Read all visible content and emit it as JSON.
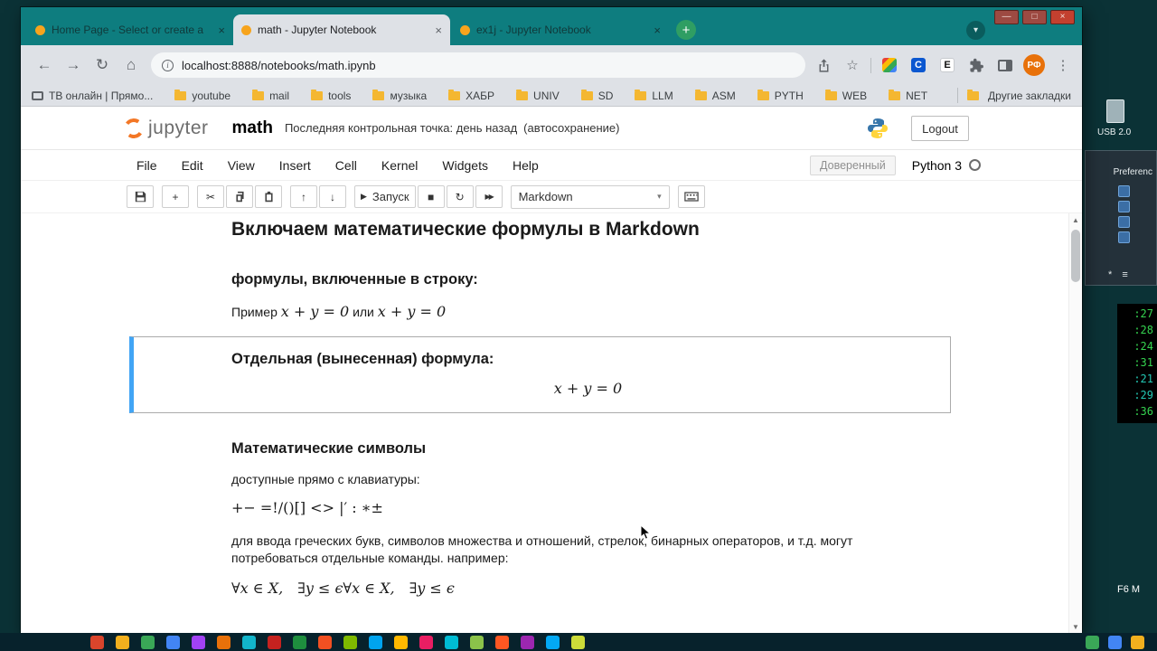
{
  "desktop": {
    "usb_label": "USB 2.0",
    "window_label": "Preferenc",
    "status_glyphs": "* ≡",
    "clock": [
      {
        "t": ":27",
        "c": "#35d450"
      },
      {
        "t": ":28",
        "c": "#35d450"
      },
      {
        "t": ":24",
        "c": "#35d450"
      },
      {
        "t": ":31",
        "c": "#35d450"
      },
      {
        "t": ":21",
        "c": "#23c8b4"
      },
      {
        "t": ":29",
        "c": "#23c8b4"
      },
      {
        "t": ":36",
        "c": "#35d450"
      }
    ],
    "f6_label": "F6 M",
    "taskbar_colors": [
      "#d9452c",
      "#f2b01e",
      "#3aa757",
      "#4285f4",
      "#a142f4",
      "#e8710a",
      "#12b5cb",
      "#c5221f",
      "#1e8e3e",
      "#f25022",
      "#7fba00",
      "#00a4ef",
      "#ffb900",
      "#e91e63",
      "#00bcd4",
      "#8bc34a",
      "#ff5722",
      "#9c27b0",
      "#03a9f4",
      "#cddc39"
    ],
    "taskbar_right_colors": [
      "#3aa757",
      "#4285f4",
      "#f2b01e"
    ]
  },
  "window_controls": {
    "minimize": "—",
    "maximize": "□",
    "close": "×"
  },
  "browser": {
    "tabs": [
      {
        "title": "Home Page - Select or create a",
        "close": "×"
      },
      {
        "title": "math - Jupyter Notebook",
        "close": "×"
      },
      {
        "title": "ex1j - Jupyter Notebook",
        "close": "×"
      }
    ],
    "new_tab_glyph": "+",
    "tab_chevron_glyph": "▾",
    "nav": {
      "back": "←",
      "forward": "→",
      "reload": "↻",
      "home": "⌂"
    },
    "address": {
      "info_glyph": "i",
      "url": "localhost:8888/notebooks/math.ipynb"
    },
    "actions": {
      "star": "☆",
      "ext_c": "C",
      "ext_e": "E",
      "profile": "РФ",
      "menu_dots": "⋮"
    },
    "bookmarks": [
      "ТВ онлайн | Прямо...",
      "youtube",
      "mail",
      "tools",
      "музыка",
      "ХАБР",
      "UNIV",
      "SD",
      "LLM",
      "ASM",
      "PYTH",
      "WEB",
      "NET"
    ],
    "other_bookmarks": "Другие закладки"
  },
  "jupyter": {
    "logo": "jupyter",
    "notebook_name": "math",
    "checkpoint": "Последняя контрольная точка: день назад",
    "autosave": "(автосохранение)",
    "logout": "Logout",
    "menus": [
      "File",
      "Edit",
      "View",
      "Insert",
      "Cell",
      "Kernel",
      "Widgets",
      "Help"
    ],
    "trusted": "Доверенный",
    "kernel_name": "Python 3",
    "toolbar": {
      "run_label": "Запуск",
      "cell_type": "Markdown",
      "glyphs": {
        "add": "+",
        "cut": "✂",
        "up": "↑",
        "down": "↓",
        "run": "▶",
        "stop": "■",
        "restart": "↻",
        "ff": "▶▶",
        "select_chevron": "▾"
      }
    },
    "scrollbar": {
      "up": "▲",
      "down": "▼"
    }
  },
  "notebook": {
    "title": "Включаем математические формулы в Markdown",
    "inline_heading": "формулы, включенные в строку:",
    "inline_example": {
      "prefix": "Пример",
      "math_a": "x + y = 0",
      "infix": "или",
      "math_b": "x + y = 0"
    },
    "display_heading": "Отдельная (вынесенная) формула:",
    "display_formula": "x + y = 0",
    "symbols_heading": "Математические символы",
    "symbols_intro": "доступные прямо с клавиатуры:",
    "symbols_line": "+− =!/()[] <> |′ : ∗±",
    "commands_text": "для ввода греческих букв, символов множества и отношений, стрелок, бинарных операторов, и т.д. могут потребоваться отдельные команды. например:",
    "commands_formula": "∀x ∈ X, ∃y ≤ ϵ∀x ∈ X, ∃y ≤ ϵ"
  }
}
